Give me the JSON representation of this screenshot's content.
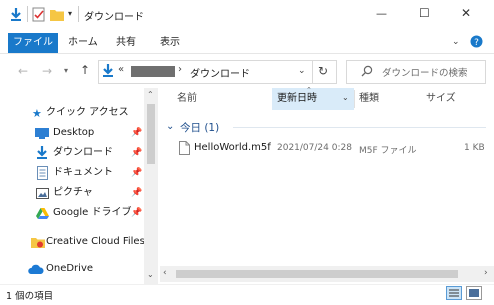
{
  "window": {
    "title": "ダウンロード",
    "controls": {
      "minimize": "—",
      "maximize": "☐",
      "close": "✕"
    }
  },
  "ribbon": {
    "tabs": [
      "ファイル",
      "ホーム",
      "共有",
      "表示"
    ]
  },
  "address": {
    "prefix": "«",
    "redacted_segment": "",
    "separator": "›",
    "current": "ダウンロード",
    "search_placeholder": "ダウンロードの検索"
  },
  "navigation": {
    "quick_access": "クイック アクセス",
    "items": [
      {
        "label": "Desktop",
        "pinned": true
      },
      {
        "label": "ダウンロード",
        "pinned": true
      },
      {
        "label": "ドキュメント",
        "pinned": true
      },
      {
        "label": "ピクチャ",
        "pinned": true
      },
      {
        "label": "Google ドライブ",
        "pinned": true
      }
    ],
    "creative_cloud": "Creative Cloud Files",
    "onedrive": "OneDrive"
  },
  "columns": {
    "name": "名前",
    "date": "更新日時",
    "type": "種類",
    "size": "サイズ"
  },
  "groups": [
    {
      "label": "今日 (1)",
      "files": [
        {
          "name": "HelloWorld.m5f",
          "date": "2021/07/24 0:28",
          "type": "M5F ファイル",
          "size": "1 KB"
        }
      ]
    }
  ],
  "status": {
    "item_count": "1 個の項目"
  },
  "colors": {
    "accent": "#1979ca",
    "folder_yellow": "#f5c644",
    "selected_header": "#d9ebf9",
    "group_label": "#1e4e8c"
  }
}
